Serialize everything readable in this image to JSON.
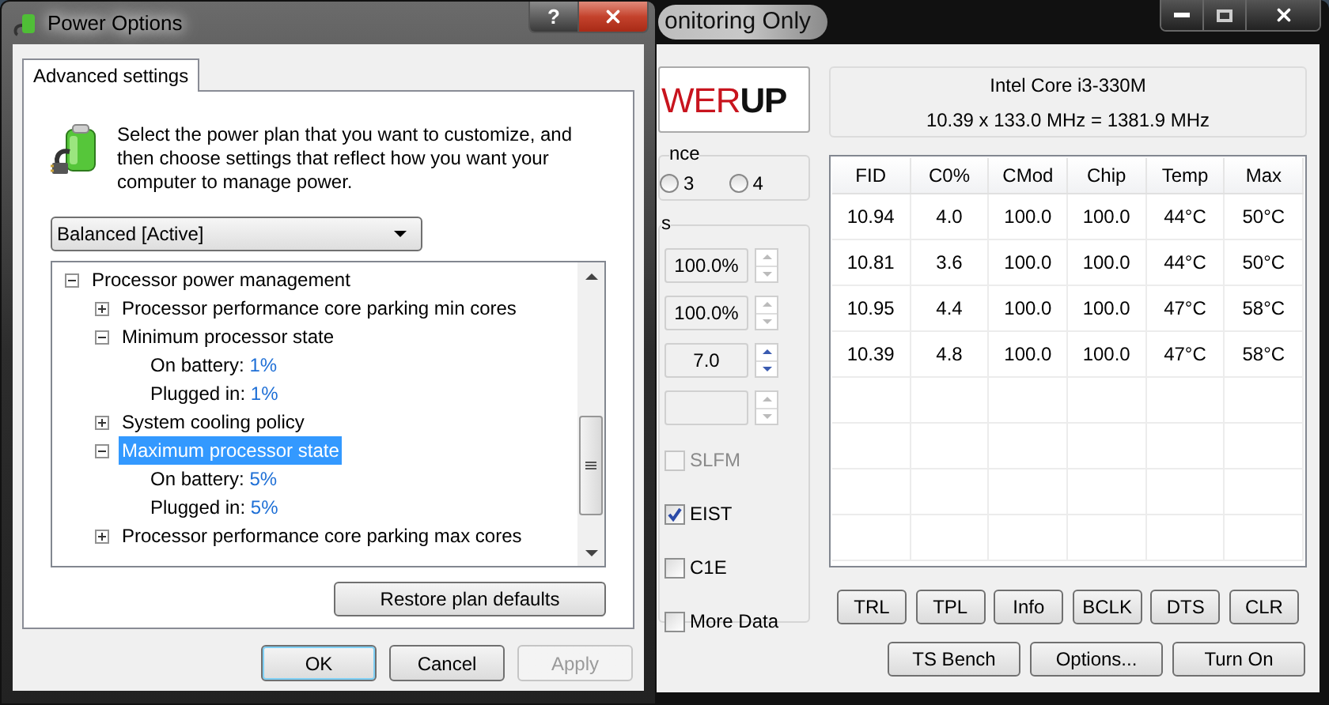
{
  "back_window": {
    "title": "onitoring Only",
    "logo": {
      "prefix": "WER",
      "suffix": "UP"
    },
    "group_1": {
      "label": "nce",
      "radios": [
        {
          "label": "3",
          "selected": false
        },
        {
          "label": "4",
          "selected": false
        }
      ]
    },
    "group_2": {
      "label": "s",
      "spinners": [
        {
          "value": "100.0%",
          "disabled": true
        },
        {
          "value": "100.0%",
          "disabled": true
        },
        {
          "value": "7.0",
          "disabled": false
        },
        {
          "disabled": true
        }
      ],
      "checkboxes": [
        {
          "label": "SLFM",
          "checked": false,
          "disabled": true
        },
        {
          "label": "EIST",
          "checked": true,
          "disabled": false
        },
        {
          "label": "C1E",
          "checked": false,
          "disabled": false
        },
        {
          "label": "More Data",
          "checked": false,
          "disabled": false
        }
      ]
    },
    "cpu_name": "Intel Core i3-330M",
    "cpu_speed": "10.39 x 133.0 MHz = 1381.9 MHz",
    "table": {
      "columns": [
        "FID",
        "C0%",
        "CMod",
        "Chip",
        "Temp",
        "Max"
      ],
      "rows": [
        [
          "10.94",
          "4.0",
          "100.0",
          "100.0",
          "44°C",
          "50°C"
        ],
        [
          "10.81",
          "3.6",
          "100.0",
          "100.0",
          "44°C",
          "50°C"
        ],
        [
          "10.95",
          "4.4",
          "100.0",
          "100.0",
          "47°C",
          "58°C"
        ],
        [
          "10.39",
          "4.8",
          "100.0",
          "100.0",
          "47°C",
          "58°C"
        ]
      ]
    },
    "tool_buttons": [
      "TRL",
      "TPL",
      "Info",
      "BCLK",
      "DTS",
      "CLR"
    ],
    "action_buttons": [
      "TS Bench",
      "Options...",
      "Turn On"
    ]
  },
  "front_window": {
    "title": "Power Options",
    "help_button": "?",
    "tabs": [
      {
        "label": "Advanced settings",
        "selected": true
      }
    ],
    "intro": "Select the power plan that you want to customize, and then choose settings that reflect how you want your computer to manage power.",
    "plan": "Balanced [Active]",
    "tree": [
      {
        "kind": "group",
        "label": "Processor power management",
        "expanded": true,
        "selected": false,
        "children": [
          {
            "kind": "group",
            "label": "Processor performance core parking min cores",
            "expanded": false,
            "selected": false
          },
          {
            "kind": "group",
            "label": "Minimum processor state",
            "expanded": true,
            "selected": false,
            "children": [
              {
                "kind": "setting",
                "label": "On battery:",
                "value": "1%",
                "selected": false
              },
              {
                "kind": "setting",
                "label": "Plugged in:",
                "value": "1%",
                "selected": false
              }
            ]
          },
          {
            "kind": "group",
            "label": "System cooling policy",
            "expanded": false,
            "selected": false
          },
          {
            "kind": "group",
            "label": "Maximum processor state",
            "expanded": true,
            "selected": true,
            "children": [
              {
                "kind": "setting",
                "label": "On battery:",
                "value": "5%",
                "selected": false
              },
              {
                "kind": "setting",
                "label": "Plugged in:",
                "value": "5%",
                "selected": false
              }
            ]
          },
          {
            "kind": "group",
            "label": "Processor performance core parking max cores",
            "expanded": false,
            "selected": false
          }
        ]
      }
    ],
    "restore_button": "Restore plan defaults",
    "buttons": [
      {
        "label": "OK",
        "disabled": false
      },
      {
        "label": "Cancel",
        "disabled": false
      },
      {
        "label": "Apply",
        "disabled": true
      }
    ]
  }
}
